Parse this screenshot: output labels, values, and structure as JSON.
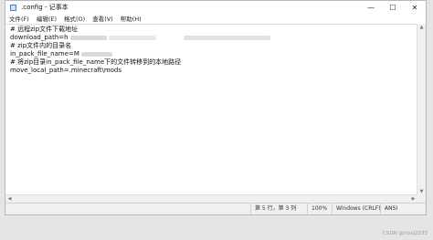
{
  "window": {
    "title": ".config - 记事本",
    "buttons": {
      "minimize": "—",
      "maximize": "☐",
      "close": "✕"
    }
  },
  "menu": [
    "文件(F)",
    "编辑(E)",
    "格式(O)",
    "查看(V)",
    "帮助(H)"
  ],
  "editor": {
    "lines": [
      "# 远程zip文件下载地址",
      "download_path=h",
      "# zip文件内的目录名",
      "in_pack_file_name=M",
      "# 将zip目录in_pack_file_name下的文件转移到的本地路径",
      "move_local_path=.minecraft\\mods"
    ]
  },
  "status": {
    "position": "第 5 行，第 3 列",
    "zoom": "100%",
    "line_ending": "Windows (CRLF)",
    "encoding": "ANSI"
  },
  "watermark": "CSDN @rtxsj2233"
}
